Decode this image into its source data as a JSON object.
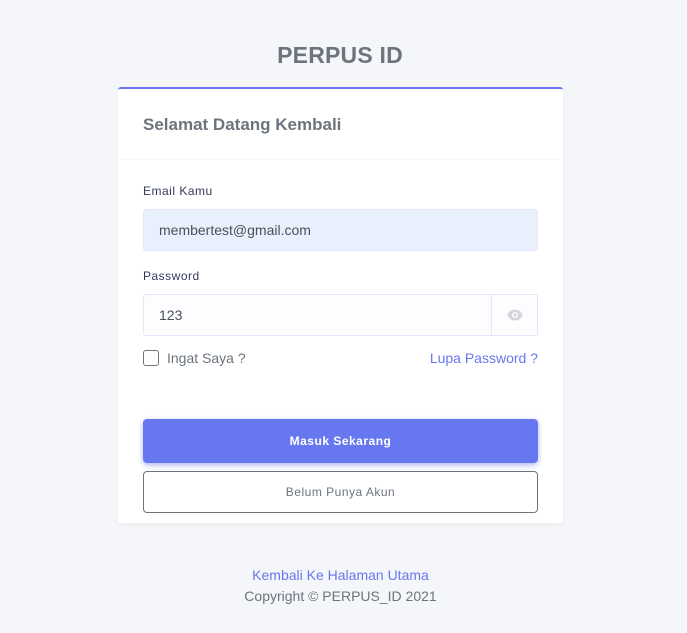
{
  "brand": "PERPUS ID",
  "card": {
    "title": "Selamat Datang Kembali",
    "email": {
      "label": "Email Kamu",
      "value": "membertest@gmail.com"
    },
    "password": {
      "label": "Password",
      "value": "123",
      "toggle_icon": "eye-icon"
    },
    "remember_label": "Ingat Saya ?",
    "forgot_label": "Lupa Password ?",
    "login_button": "Masuk Sekarang",
    "register_button": "Belum Punya Akun"
  },
  "footer": {
    "home_link": "Kembali Ke Halaman Utama",
    "copyright": "Copyright © PERPUS_ID 2021"
  },
  "colors": {
    "accent": "#6777ef",
    "text_muted": "#6c757d",
    "background": "#f4f6f9",
    "autofill_bg": "#e8f0fe"
  }
}
